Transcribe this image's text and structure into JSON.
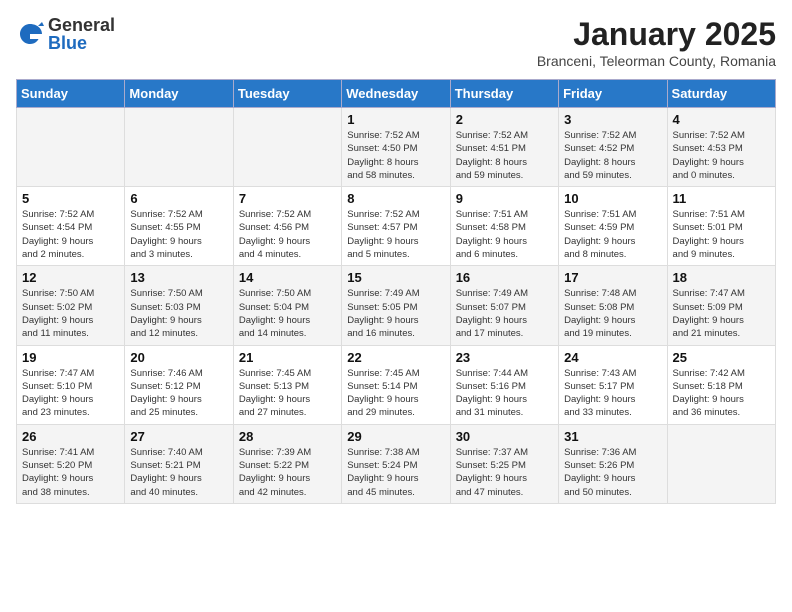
{
  "header": {
    "logo_general": "General",
    "logo_blue": "Blue",
    "month_title": "January 2025",
    "location": "Branceni, Teleorman County, Romania"
  },
  "weekdays": [
    "Sunday",
    "Monday",
    "Tuesday",
    "Wednesday",
    "Thursday",
    "Friday",
    "Saturday"
  ],
  "weeks": [
    [
      {
        "day": "",
        "info": ""
      },
      {
        "day": "",
        "info": ""
      },
      {
        "day": "",
        "info": ""
      },
      {
        "day": "1",
        "info": "Sunrise: 7:52 AM\nSunset: 4:50 PM\nDaylight: 8 hours\nand 58 minutes."
      },
      {
        "day": "2",
        "info": "Sunrise: 7:52 AM\nSunset: 4:51 PM\nDaylight: 8 hours\nand 59 minutes."
      },
      {
        "day": "3",
        "info": "Sunrise: 7:52 AM\nSunset: 4:52 PM\nDaylight: 8 hours\nand 59 minutes."
      },
      {
        "day": "4",
        "info": "Sunrise: 7:52 AM\nSunset: 4:53 PM\nDaylight: 9 hours\nand 0 minutes."
      }
    ],
    [
      {
        "day": "5",
        "info": "Sunrise: 7:52 AM\nSunset: 4:54 PM\nDaylight: 9 hours\nand 2 minutes."
      },
      {
        "day": "6",
        "info": "Sunrise: 7:52 AM\nSunset: 4:55 PM\nDaylight: 9 hours\nand 3 minutes."
      },
      {
        "day": "7",
        "info": "Sunrise: 7:52 AM\nSunset: 4:56 PM\nDaylight: 9 hours\nand 4 minutes."
      },
      {
        "day": "8",
        "info": "Sunrise: 7:52 AM\nSunset: 4:57 PM\nDaylight: 9 hours\nand 5 minutes."
      },
      {
        "day": "9",
        "info": "Sunrise: 7:51 AM\nSunset: 4:58 PM\nDaylight: 9 hours\nand 6 minutes."
      },
      {
        "day": "10",
        "info": "Sunrise: 7:51 AM\nSunset: 4:59 PM\nDaylight: 9 hours\nand 8 minutes."
      },
      {
        "day": "11",
        "info": "Sunrise: 7:51 AM\nSunset: 5:01 PM\nDaylight: 9 hours\nand 9 minutes."
      }
    ],
    [
      {
        "day": "12",
        "info": "Sunrise: 7:50 AM\nSunset: 5:02 PM\nDaylight: 9 hours\nand 11 minutes."
      },
      {
        "day": "13",
        "info": "Sunrise: 7:50 AM\nSunset: 5:03 PM\nDaylight: 9 hours\nand 12 minutes."
      },
      {
        "day": "14",
        "info": "Sunrise: 7:50 AM\nSunset: 5:04 PM\nDaylight: 9 hours\nand 14 minutes."
      },
      {
        "day": "15",
        "info": "Sunrise: 7:49 AM\nSunset: 5:05 PM\nDaylight: 9 hours\nand 16 minutes."
      },
      {
        "day": "16",
        "info": "Sunrise: 7:49 AM\nSunset: 5:07 PM\nDaylight: 9 hours\nand 17 minutes."
      },
      {
        "day": "17",
        "info": "Sunrise: 7:48 AM\nSunset: 5:08 PM\nDaylight: 9 hours\nand 19 minutes."
      },
      {
        "day": "18",
        "info": "Sunrise: 7:47 AM\nSunset: 5:09 PM\nDaylight: 9 hours\nand 21 minutes."
      }
    ],
    [
      {
        "day": "19",
        "info": "Sunrise: 7:47 AM\nSunset: 5:10 PM\nDaylight: 9 hours\nand 23 minutes."
      },
      {
        "day": "20",
        "info": "Sunrise: 7:46 AM\nSunset: 5:12 PM\nDaylight: 9 hours\nand 25 minutes."
      },
      {
        "day": "21",
        "info": "Sunrise: 7:45 AM\nSunset: 5:13 PM\nDaylight: 9 hours\nand 27 minutes."
      },
      {
        "day": "22",
        "info": "Sunrise: 7:45 AM\nSunset: 5:14 PM\nDaylight: 9 hours\nand 29 minutes."
      },
      {
        "day": "23",
        "info": "Sunrise: 7:44 AM\nSunset: 5:16 PM\nDaylight: 9 hours\nand 31 minutes."
      },
      {
        "day": "24",
        "info": "Sunrise: 7:43 AM\nSunset: 5:17 PM\nDaylight: 9 hours\nand 33 minutes."
      },
      {
        "day": "25",
        "info": "Sunrise: 7:42 AM\nSunset: 5:18 PM\nDaylight: 9 hours\nand 36 minutes."
      }
    ],
    [
      {
        "day": "26",
        "info": "Sunrise: 7:41 AM\nSunset: 5:20 PM\nDaylight: 9 hours\nand 38 minutes."
      },
      {
        "day": "27",
        "info": "Sunrise: 7:40 AM\nSunset: 5:21 PM\nDaylight: 9 hours\nand 40 minutes."
      },
      {
        "day": "28",
        "info": "Sunrise: 7:39 AM\nSunset: 5:22 PM\nDaylight: 9 hours\nand 42 minutes."
      },
      {
        "day": "29",
        "info": "Sunrise: 7:38 AM\nSunset: 5:24 PM\nDaylight: 9 hours\nand 45 minutes."
      },
      {
        "day": "30",
        "info": "Sunrise: 7:37 AM\nSunset: 5:25 PM\nDaylight: 9 hours\nand 47 minutes."
      },
      {
        "day": "31",
        "info": "Sunrise: 7:36 AM\nSunset: 5:26 PM\nDaylight: 9 hours\nand 50 minutes."
      },
      {
        "day": "",
        "info": ""
      }
    ]
  ]
}
